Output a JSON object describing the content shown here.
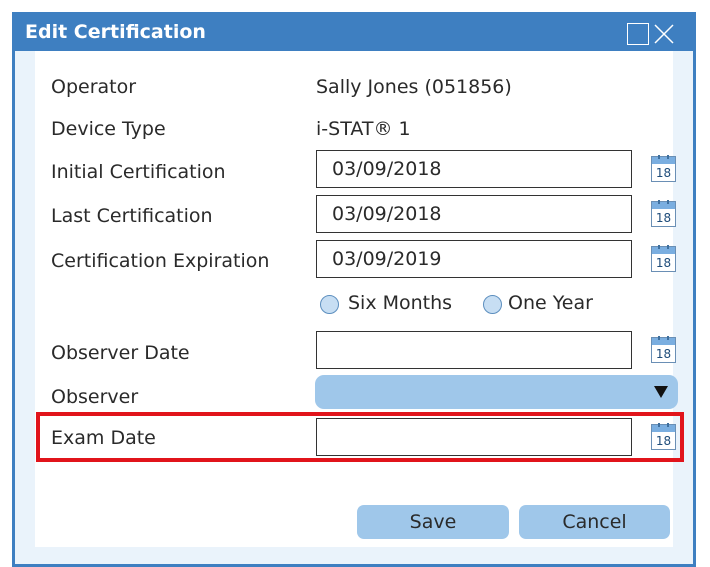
{
  "dialog": {
    "title": "Edit Certification",
    "accent_color": "#3e7fc1",
    "highlight_color": "#e1141b"
  },
  "form": {
    "operator": {
      "label": "Operator",
      "value": "Sally Jones (051856)"
    },
    "device_type": {
      "label": "Device Type",
      "value": "i-STAT® 1"
    },
    "initial_certification": {
      "label": "Initial Certification",
      "value": "03/09/2018"
    },
    "last_certification": {
      "label": "Last Certification",
      "value": "03/09/2018"
    },
    "certification_expiration": {
      "label": "Certification Expiration",
      "value": "03/09/2019"
    },
    "period_options": [
      "Six Months",
      "One Year"
    ],
    "observer_date": {
      "label": "Observer Date",
      "value": ""
    },
    "observer": {
      "label": "Observer",
      "value": ""
    },
    "exam_date": {
      "label": "Exam Date",
      "value": ""
    }
  },
  "calendar_icon": {
    "name": "calendar-icon",
    "day": "18"
  },
  "buttons": {
    "save": "Save",
    "cancel": "Cancel"
  }
}
